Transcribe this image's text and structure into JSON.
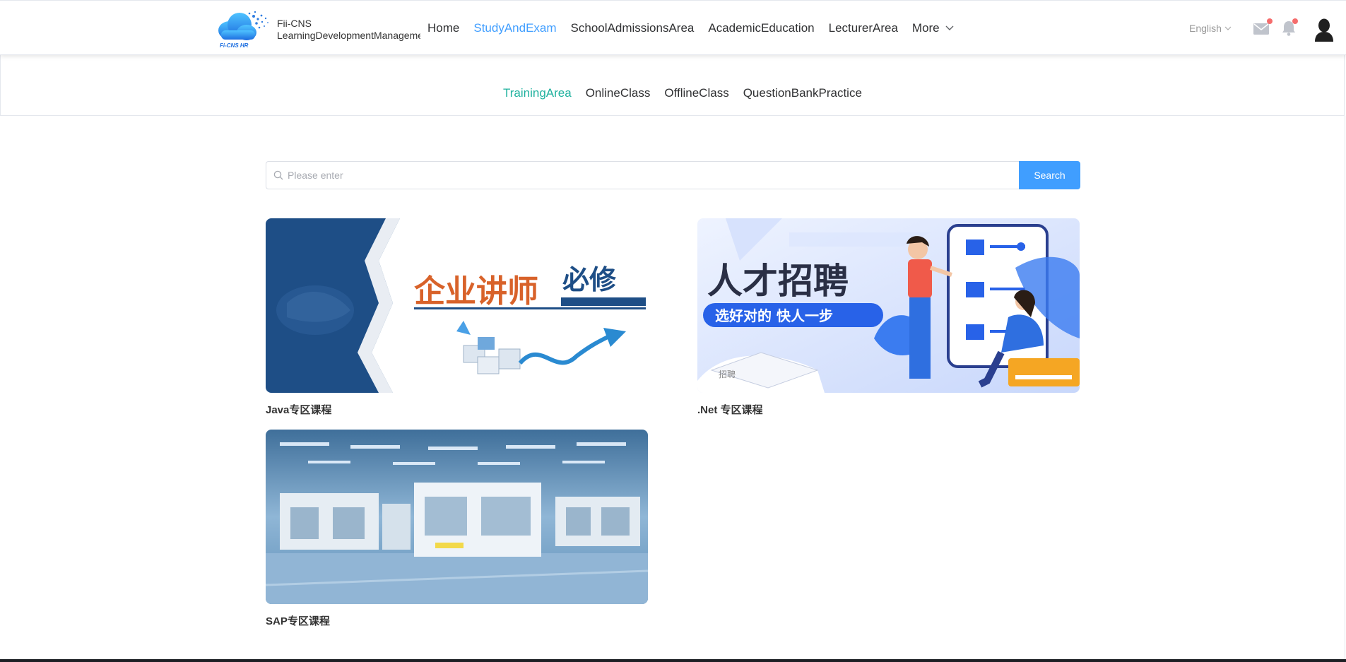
{
  "header": {
    "brand_line1": "Fii-CNS",
    "brand_line2": "LearningDevelopmentManagement",
    "logo_text": "Fi-CNS HR",
    "nav": [
      {
        "label": "Home",
        "active": false
      },
      {
        "label": "StudyAndExam",
        "active": true
      },
      {
        "label": "SchoolAdmissionsArea",
        "active": false
      },
      {
        "label": "AcademicEducation",
        "active": false
      },
      {
        "label": "LecturerArea",
        "active": false
      }
    ],
    "more_label": "More",
    "language": "English",
    "icons": [
      "mail-icon",
      "bell-icon",
      "avatar-icon"
    ],
    "active_color": "#409eff"
  },
  "subnav": {
    "items": [
      {
        "label": "TrainingArea",
        "active": true
      },
      {
        "label": "OnlineClass",
        "active": false
      },
      {
        "label": "OfflineClass",
        "active": false
      },
      {
        "label": "QuestionBankPractice",
        "active": false
      }
    ],
    "active_color": "#1fb19e"
  },
  "search": {
    "placeholder": "Please enter",
    "value": "",
    "button_label": "Search"
  },
  "courses": [
    {
      "title": "Java专区课程",
      "banner_text": "企业讲师",
      "banner_text2": "必修"
    },
    {
      "title": ".Net 专区课程",
      "banner_text": "人才招聘",
      "banner_sub": "选好对的  快人一步",
      "book_text": "招聘"
    },
    {
      "title": "SAP专区课程"
    }
  ]
}
